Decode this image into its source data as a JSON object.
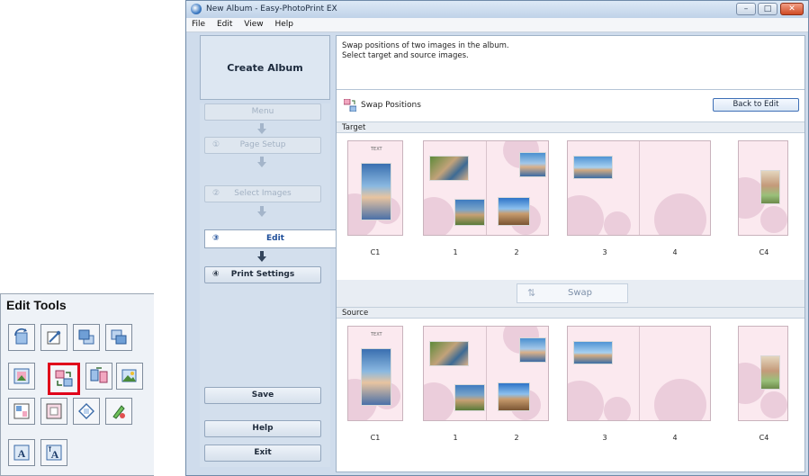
{
  "edit_tools": {
    "title": "Edit Tools",
    "tools": [
      {
        "icon": "rotate-icon"
      },
      {
        "icon": "trim-icon"
      },
      {
        "icon": "bring-front-icon"
      },
      {
        "icon": "send-back-icon"
      },
      {
        "icon": "replace-image-icon"
      },
      {
        "icon": "swap-positions-icon",
        "selected": true
      },
      {
        "icon": "swap-pages-icon"
      },
      {
        "icon": "image-adjust-icon"
      },
      {
        "icon": "layout-icon"
      },
      {
        "icon": "frame-icon"
      },
      {
        "icon": "shape-icon"
      },
      {
        "icon": "color-icon"
      },
      {
        "icon": "text-icon"
      },
      {
        "icon": "vertical-text-icon"
      }
    ]
  },
  "window": {
    "title": "New Album - Easy-PhotoPrint EX",
    "menu": [
      "File",
      "Edit",
      "View",
      "Help"
    ]
  },
  "nav": {
    "header": "Create Album",
    "menu": "Menu",
    "page_setup_num": "①",
    "page_setup": "Page Setup",
    "select_images_num": "②",
    "select_images": "Select Images",
    "edit_num": "③",
    "edit": "Edit",
    "print_settings_num": "④",
    "print_settings": "Print Settings",
    "save": "Save",
    "help": "Help",
    "exit": "Exit"
  },
  "main": {
    "instruction_line1": "Swap positions of two images in the album.",
    "instruction_line2": "Select target and source images.",
    "swap_title": "Swap Positions",
    "back_to_edit": "Back to Edit",
    "target_label": "Target",
    "source_label": "Source",
    "swap_label": "Swap",
    "swap_symbol": "⇅",
    "cover_text": "TEXT",
    "page_labels": [
      "C1",
      "1",
      "2",
      "3",
      "4",
      "C4"
    ]
  },
  "colors": {
    "selected_tool_border": "#e0001a",
    "page_background": "#fbe9ef",
    "accent": "#3e6fb6"
  }
}
